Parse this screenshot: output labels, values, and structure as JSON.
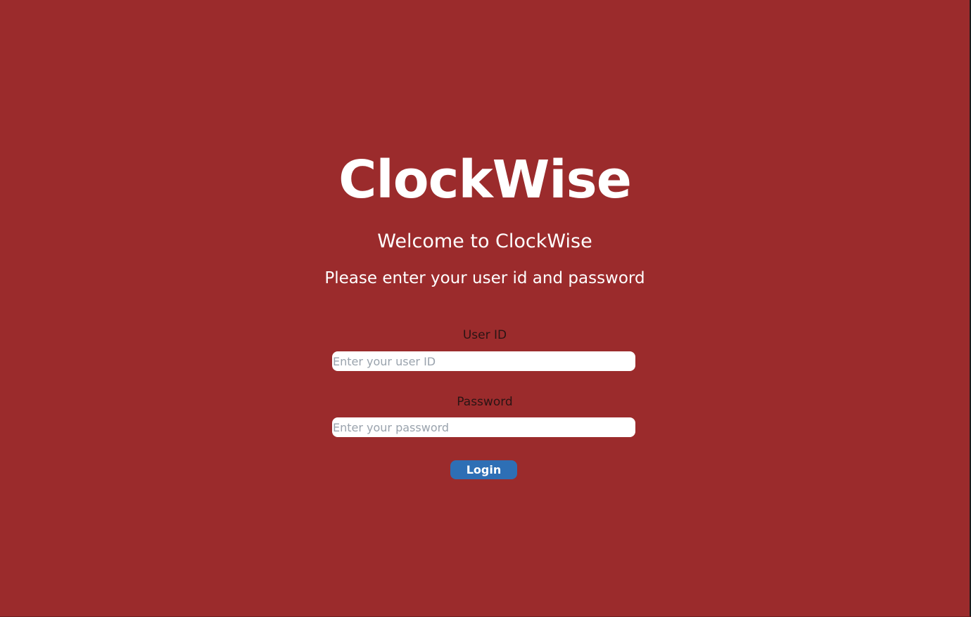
{
  "app": {
    "title": "ClockWise",
    "welcome": "Welcome to ClockWise",
    "instructions": "Please enter your user id and password"
  },
  "form": {
    "user_id": {
      "label": "User ID",
      "value": "",
      "placeholder": "Enter your user ID"
    },
    "password": {
      "label": "Password",
      "value": "",
      "placeholder": "Enter your password"
    },
    "login_label": "Login"
  },
  "colors": {
    "background": "#9b2b2c",
    "button": "#2e6fb5",
    "text_primary": "#ffffff",
    "label_text": "#2a1414",
    "placeholder": "#9aa3ad"
  }
}
